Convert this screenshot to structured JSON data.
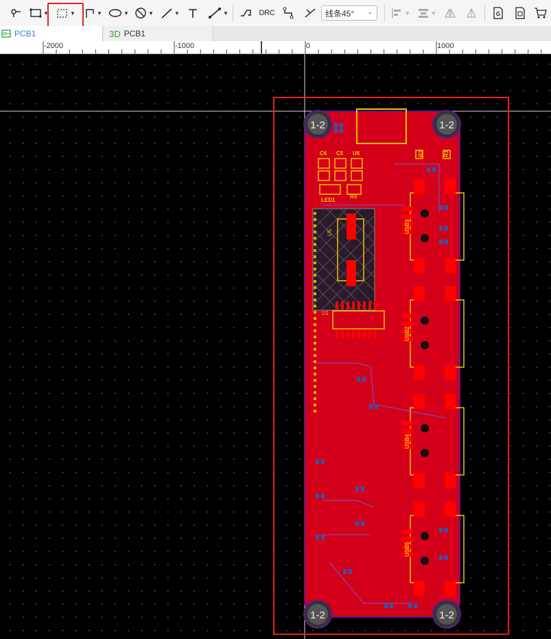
{
  "toolbar": {
    "tools": [
      "pin-tool",
      "rect-tool",
      "select-region-tool",
      "polyline-tool",
      "ellipse-tool",
      "circle-no-tool",
      "line-tool",
      "text-tool",
      "dimension-tool",
      "route-tool",
      "drc",
      "via-tool",
      "corner-tool"
    ],
    "drc_label": "DRC",
    "line_mode": "线条45°"
  },
  "tabs": [
    {
      "icon": "pcb-icon",
      "label": "PCB1",
      "active": true
    },
    {
      "icon": "3d-icon",
      "label": "PCB1",
      "prefix": "3D",
      "active": false
    }
  ],
  "ruler": {
    "labels": [
      "-2000",
      "-1000",
      "0",
      "1000"
    ]
  },
  "board": {
    "mount_hole_label": "1-2",
    "components": [
      "C6",
      "C5",
      "U6",
      "R2",
      "R1",
      "LED1",
      "R3",
      "U5",
      "U1",
      "USB1",
      "USB2",
      "USB3",
      "USB4",
      "USB5"
    ]
  },
  "colors": {
    "copper": "#d4001a",
    "silk": "#f5c400",
    "pad": "#ff0000",
    "board_outline": "#5a1a8a",
    "highlight": "#e8201c"
  }
}
